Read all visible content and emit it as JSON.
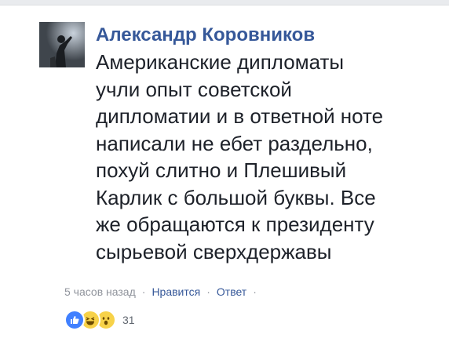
{
  "comment": {
    "author": "Александр Коровников",
    "lines": [
      "Американские дипломаты",
      "учли опыт советской",
      "дипломатии и в ответной ноте",
      "написали не ебет раздельно,",
      "похуй слитно и Плешивый",
      "Карлик с большой буквы. Все",
      "же обращаются к президенту",
      "сырьевой сверхдержавы"
    ],
    "timestamp": "5 часов назад",
    "like_label": "Нравится",
    "reply_label": "Ответ",
    "separator": "·",
    "reaction_count": "31"
  },
  "reactions": [
    "like-icon",
    "haha-icon",
    "wow-icon"
  ],
  "colors": {
    "author": "#365899",
    "text": "#1d2129",
    "meta": "#90949c",
    "like_blue": "#4080ff",
    "emoji_yellow": "#f7d249"
  }
}
